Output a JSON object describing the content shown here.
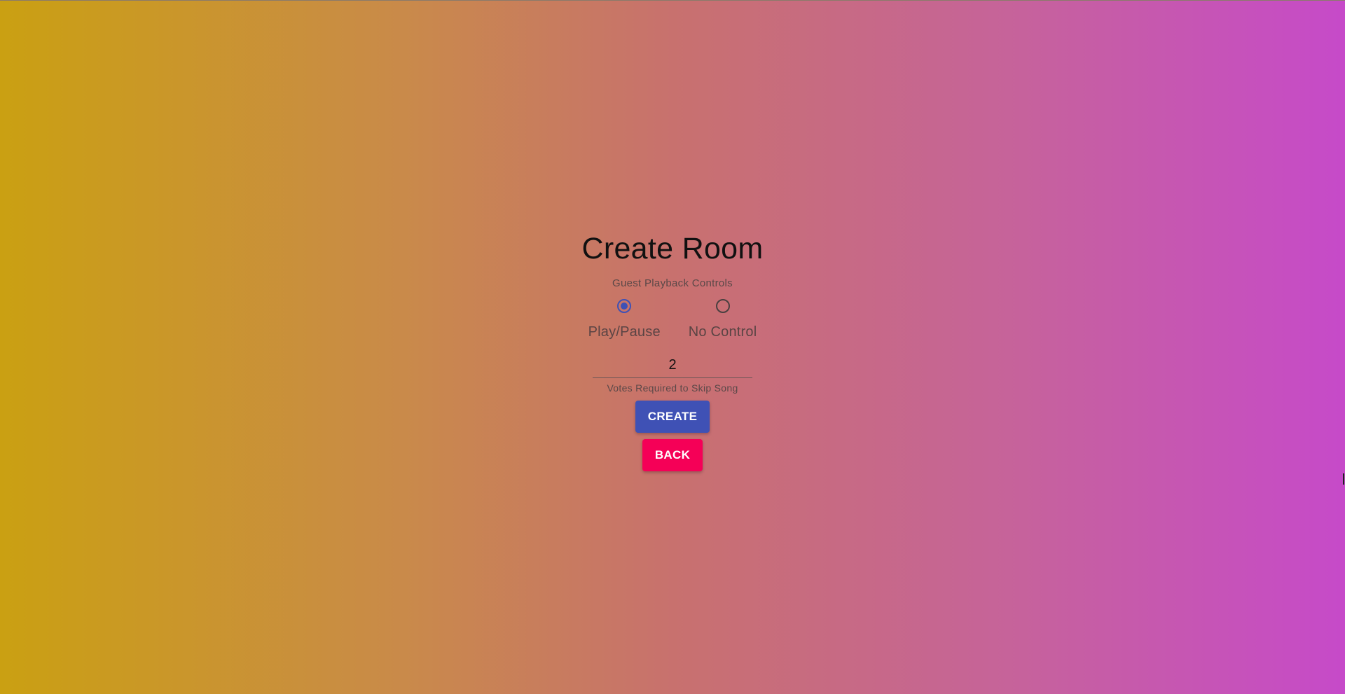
{
  "page": {
    "title": "Create Room",
    "background_colors": [
      "#caa012",
      "#c98a4a",
      "#c8716e",
      "#c6639a",
      "#c64ac9"
    ]
  },
  "playback": {
    "helper_text": "Guest Playback Controls",
    "options": [
      {
        "label": "Play/Pause",
        "checked": true
      },
      {
        "label": "No Control",
        "checked": false
      }
    ],
    "accent_color": "#3f51b5"
  },
  "votes": {
    "value": "2",
    "helper_text": "Votes Required to Skip Song"
  },
  "buttons": {
    "create_label": "CREATE",
    "create_color": "#3f51b5",
    "back_label": "BACK",
    "back_color": "#f50057"
  }
}
